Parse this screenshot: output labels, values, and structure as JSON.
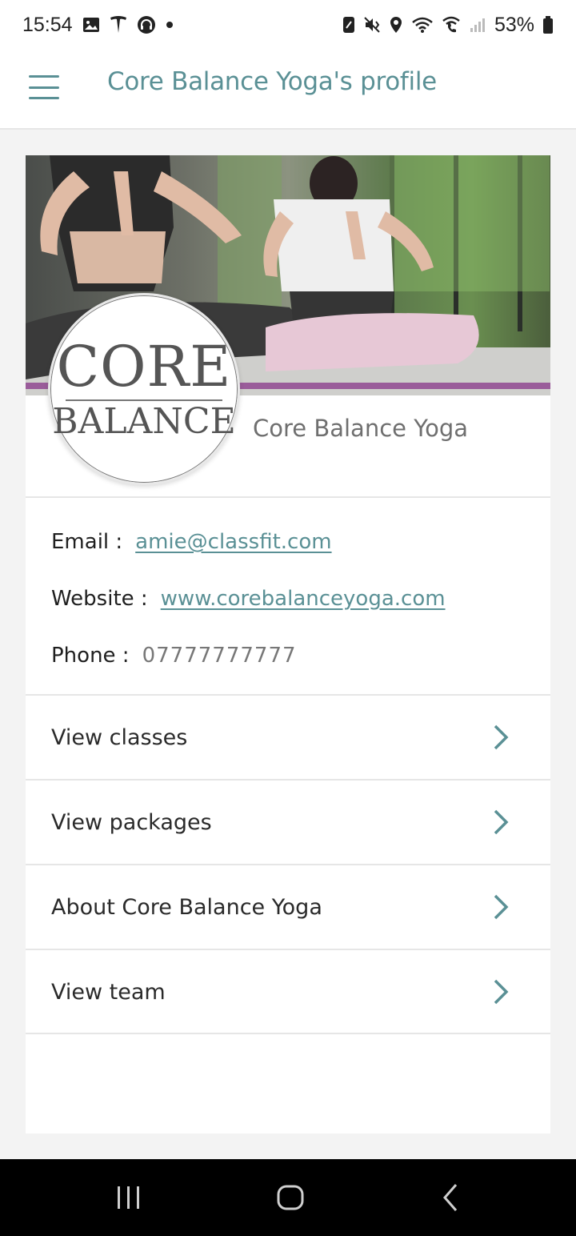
{
  "status_bar": {
    "time": "15:54",
    "battery": "53%",
    "left_icons": [
      "gallery-icon",
      "tesla-icon",
      "headset-icon",
      "dot-icon"
    ],
    "right_icons": [
      "nfc-icon",
      "mute-vibrate-icon",
      "location-icon",
      "wifi-icon",
      "wifi-call-icon",
      "signal-icon",
      "battery-icon"
    ]
  },
  "app_bar": {
    "menu_icon": "hamburger-menu-icon",
    "title": "Core Balance Yoga's profile"
  },
  "profile": {
    "logo_top": "CORE",
    "logo_bottom": "BALANCE",
    "name": "Core Balance Yoga",
    "contact": {
      "email_label": "Email :",
      "email": "amie@classfit.com",
      "website_label": "Website :",
      "website": "www.corebalanceyoga.com",
      "phone_label": "Phone :",
      "phone": "07777777777"
    }
  },
  "menu": [
    {
      "label": "View classes",
      "icon": "chevron-right-icon"
    },
    {
      "label": "View packages",
      "icon": "chevron-right-icon"
    },
    {
      "label": "About Core Balance Yoga",
      "icon": "chevron-right-icon"
    },
    {
      "label": "View team",
      "icon": "chevron-right-icon"
    }
  ],
  "system_nav": [
    "recents-icon",
    "home-icon",
    "back-icon"
  ],
  "colors": {
    "accent": "#5a9095",
    "background": "#f3f3f3",
    "card": "#ffffff",
    "system_nav": "#000000"
  }
}
